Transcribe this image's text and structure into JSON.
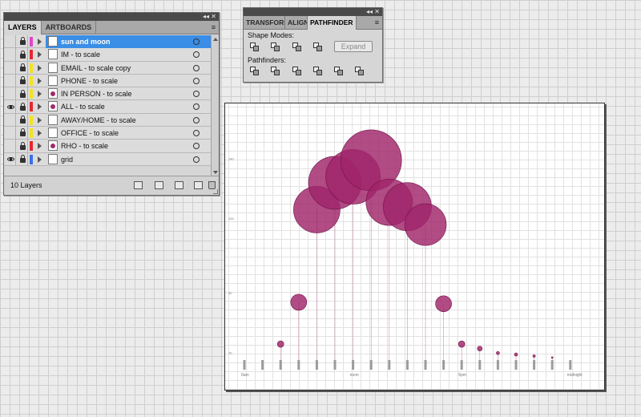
{
  "layers_panel": {
    "tabs": [
      {
        "label": "LAYERS",
        "active": true
      },
      {
        "label": "ARTBOARDS",
        "active": false
      }
    ],
    "title_controls": {
      "collapse": "◂◂",
      "close": "✕"
    },
    "menu_icon": "≡",
    "layers": [
      {
        "name": "sun and moon",
        "visible": false,
        "locked": true,
        "color": "#e046c8",
        "selected": true,
        "thumb": false
      },
      {
        "name": "IM - to scale",
        "visible": false,
        "locked": true,
        "color": "#e8262f",
        "selected": false,
        "thumb": false
      },
      {
        "name": "EMAIL - to scale copy",
        "visible": false,
        "locked": true,
        "color": "#f4e321",
        "selected": false,
        "thumb": false
      },
      {
        "name": "PHONE - to scale",
        "visible": false,
        "locked": true,
        "color": "#f4e321",
        "selected": false,
        "thumb": false
      },
      {
        "name": "IN PERSON - to scale",
        "visible": false,
        "locked": true,
        "color": "#f4e321",
        "selected": false,
        "thumb": true
      },
      {
        "name": "ALL - to scale",
        "visible": true,
        "locked": true,
        "color": "#e8262f",
        "selected": false,
        "thumb": true
      },
      {
        "name": "AWAY/HOME - to scale",
        "visible": false,
        "locked": true,
        "color": "#f4e321",
        "selected": false,
        "thumb": false
      },
      {
        "name": "OFFICE - to scale",
        "visible": false,
        "locked": true,
        "color": "#f4e321",
        "selected": false,
        "thumb": false
      },
      {
        "name": "RHO - to scale",
        "visible": false,
        "locked": true,
        "color": "#e8262f",
        "selected": false,
        "thumb": true
      },
      {
        "name": "grid",
        "visible": true,
        "locked": true,
        "color": "#3a6fe6",
        "selected": false,
        "thumb": false
      }
    ],
    "footer": {
      "count_label": "10 Layers"
    }
  },
  "pathfinder_panel": {
    "tabs": [
      {
        "label": "TRANSFORM",
        "active": false
      },
      {
        "label": "ALIGN",
        "active": false
      },
      {
        "label": "PATHFINDER",
        "active": true
      }
    ],
    "title_controls": {
      "collapse": "◂◂",
      "close": "✕"
    },
    "menu_icon": "≡",
    "shape_modes_label": "Shape Modes:",
    "pathfinders_label": "Pathfinders:",
    "expand_label": "Expand"
  },
  "chart_data": {
    "type": "bubble-timeline",
    "accent": "#a0246a",
    "x_tick_labels": [
      "6am",
      "noon",
      "6pm",
      "midnight"
    ],
    "y_tick_labels": [
      "140",
      "100",
      "50",
      "10"
    ],
    "ylim": [
      0,
      160
    ],
    "bubbles": [
      {
        "slot": 1,
        "value": 4,
        "r": 0
      },
      {
        "slot": 2,
        "value": 15,
        "r": 4
      },
      {
        "slot": 3,
        "value": 43,
        "r": 10
      },
      {
        "slot": 4,
        "value": 105,
        "r": 29
      },
      {
        "slot": 5,
        "value": 123,
        "r": 33
      },
      {
        "slot": 6,
        "value": 127,
        "r": 34
      },
      {
        "slot": 7,
        "value": 138,
        "r": 38
      },
      {
        "slot": 8,
        "value": 110,
        "r": 29
      },
      {
        "slot": 9,
        "value": 107,
        "r": 30
      },
      {
        "slot": 10,
        "value": 95,
        "r": 26
      },
      {
        "slot": 11,
        "value": 42,
        "r": 10
      },
      {
        "slot": 12,
        "value": 15,
        "r": 4
      },
      {
        "slot": 13,
        "value": 12,
        "r": 3
      },
      {
        "slot": 14,
        "value": 9,
        "r": 2
      },
      {
        "slot": 15,
        "value": 8,
        "r": 2
      },
      {
        "slot": 16,
        "value": 7,
        "r": 1.5
      },
      {
        "slot": 17,
        "value": 6,
        "r": 1
      }
    ],
    "tick_slots": 19
  }
}
